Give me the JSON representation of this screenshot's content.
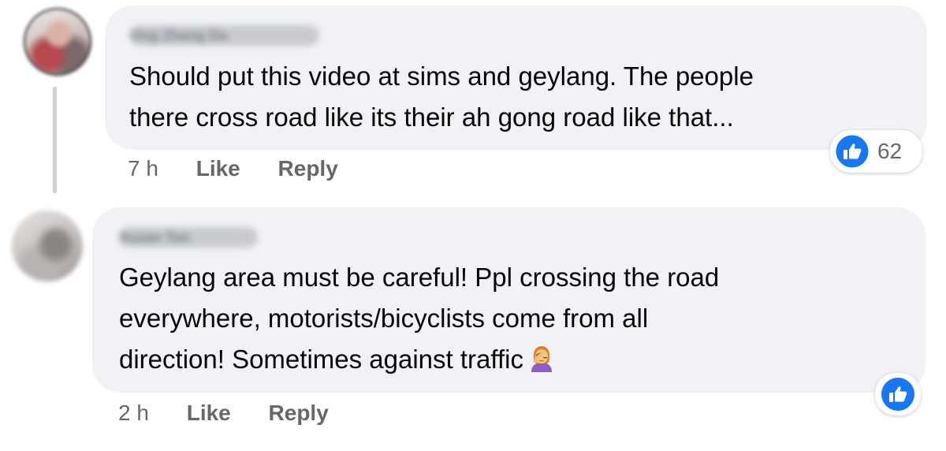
{
  "comments": [
    {
      "author": "Ong Zhang Da",
      "text": "Should put this video at sims and geylang. The people\nthere cross road like its their ah gong road like that...",
      "time": "7 h",
      "like_label": "Like",
      "reply_label": "Reply",
      "reaction_count": "62"
    },
    {
      "author": "Susan Tan",
      "text": "Geylang area must be careful! Ppl crossing the road\neverywhere, motorists/bicyclists come from all\ndirection! Sometimes against traffic",
      "time": "2 h",
      "like_label": "Like",
      "reply_label": "Reply"
    }
  ],
  "colors": {
    "bubble": "#f0f2f5",
    "meta_text": "#65676b",
    "like_blue": "#1877f2"
  },
  "icons": [
    "like-thumb-icon",
    "person-facepalming-emoji"
  ]
}
